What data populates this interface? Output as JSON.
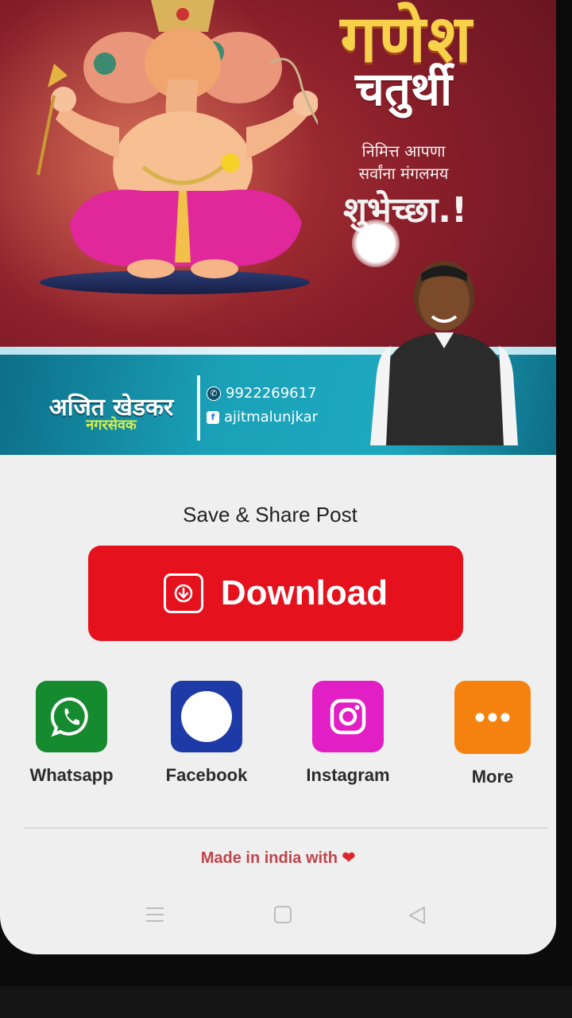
{
  "poster": {
    "title": "गणेश",
    "subtitle": "चतुर्थी",
    "wish_line1": "निमित्त आपणा",
    "wish_line2": "सर्वांना मंगलमय",
    "wish_big": "शुभेच्छा.!",
    "leader_name": "अजित खेडकर",
    "leader_role": "नगरसेवक",
    "phone": "9922269617",
    "facebook": "ajitmalunjkar"
  },
  "sheet": {
    "title": "Save & Share Post",
    "download_label": "Download",
    "share": [
      {
        "label": "Whatsapp",
        "color": "#168a2e",
        "icon": "whatsapp-icon"
      },
      {
        "label": "Facebook",
        "color": "#1e3aa6",
        "icon": "facebook-icon"
      },
      {
        "label": "Instagram",
        "color": "#e21fc4",
        "icon": "instagram-icon"
      },
      {
        "label": "More",
        "color": "#f5820f",
        "icon": "more-icon"
      }
    ],
    "footer": "Made in india with"
  },
  "colors": {
    "download": "#e5111d",
    "heart": "#e0242c"
  }
}
